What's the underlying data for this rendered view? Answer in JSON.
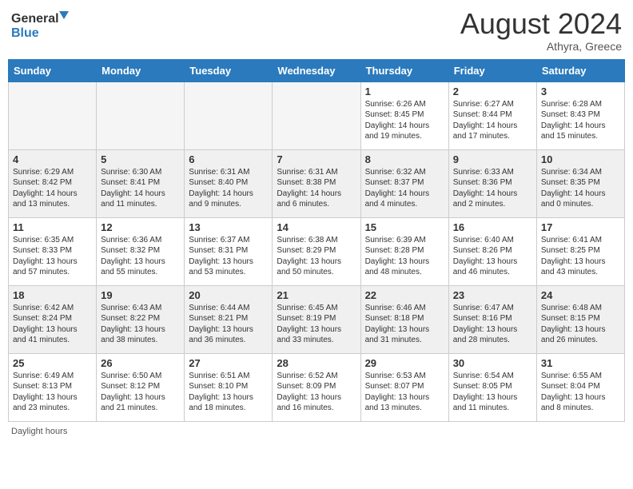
{
  "header": {
    "logo_text1": "General",
    "logo_text2": "Blue",
    "month_year": "August 2024",
    "location": "Athyra, Greece"
  },
  "days_of_week": [
    "Sunday",
    "Monday",
    "Tuesday",
    "Wednesday",
    "Thursday",
    "Friday",
    "Saturday"
  ],
  "weeks": [
    [
      {
        "day": "",
        "empty": true
      },
      {
        "day": "",
        "empty": true
      },
      {
        "day": "",
        "empty": true
      },
      {
        "day": "",
        "empty": true
      },
      {
        "day": "1",
        "sunrise": "Sunrise: 6:26 AM",
        "sunset": "Sunset: 8:45 PM",
        "daylight": "Daylight: 14 hours and 19 minutes."
      },
      {
        "day": "2",
        "sunrise": "Sunrise: 6:27 AM",
        "sunset": "Sunset: 8:44 PM",
        "daylight": "Daylight: 14 hours and 17 minutes."
      },
      {
        "day": "3",
        "sunrise": "Sunrise: 6:28 AM",
        "sunset": "Sunset: 8:43 PM",
        "daylight": "Daylight: 14 hours and 15 minutes."
      }
    ],
    [
      {
        "day": "4",
        "sunrise": "Sunrise: 6:29 AM",
        "sunset": "Sunset: 8:42 PM",
        "daylight": "Daylight: 14 hours and 13 minutes."
      },
      {
        "day": "5",
        "sunrise": "Sunrise: 6:30 AM",
        "sunset": "Sunset: 8:41 PM",
        "daylight": "Daylight: 14 hours and 11 minutes."
      },
      {
        "day": "6",
        "sunrise": "Sunrise: 6:31 AM",
        "sunset": "Sunset: 8:40 PM",
        "daylight": "Daylight: 14 hours and 9 minutes."
      },
      {
        "day": "7",
        "sunrise": "Sunrise: 6:31 AM",
        "sunset": "Sunset: 8:38 PM",
        "daylight": "Daylight: 14 hours and 6 minutes."
      },
      {
        "day": "8",
        "sunrise": "Sunrise: 6:32 AM",
        "sunset": "Sunset: 8:37 PM",
        "daylight": "Daylight: 14 hours and 4 minutes."
      },
      {
        "day": "9",
        "sunrise": "Sunrise: 6:33 AM",
        "sunset": "Sunset: 8:36 PM",
        "daylight": "Daylight: 14 hours and 2 minutes."
      },
      {
        "day": "10",
        "sunrise": "Sunrise: 6:34 AM",
        "sunset": "Sunset: 8:35 PM",
        "daylight": "Daylight: 14 hours and 0 minutes."
      }
    ],
    [
      {
        "day": "11",
        "sunrise": "Sunrise: 6:35 AM",
        "sunset": "Sunset: 8:33 PM",
        "daylight": "Daylight: 13 hours and 57 minutes."
      },
      {
        "day": "12",
        "sunrise": "Sunrise: 6:36 AM",
        "sunset": "Sunset: 8:32 PM",
        "daylight": "Daylight: 13 hours and 55 minutes."
      },
      {
        "day": "13",
        "sunrise": "Sunrise: 6:37 AM",
        "sunset": "Sunset: 8:31 PM",
        "daylight": "Daylight: 13 hours and 53 minutes."
      },
      {
        "day": "14",
        "sunrise": "Sunrise: 6:38 AM",
        "sunset": "Sunset: 8:29 PM",
        "daylight": "Daylight: 13 hours and 50 minutes."
      },
      {
        "day": "15",
        "sunrise": "Sunrise: 6:39 AM",
        "sunset": "Sunset: 8:28 PM",
        "daylight": "Daylight: 13 hours and 48 minutes."
      },
      {
        "day": "16",
        "sunrise": "Sunrise: 6:40 AM",
        "sunset": "Sunset: 8:26 PM",
        "daylight": "Daylight: 13 hours and 46 minutes."
      },
      {
        "day": "17",
        "sunrise": "Sunrise: 6:41 AM",
        "sunset": "Sunset: 8:25 PM",
        "daylight": "Daylight: 13 hours and 43 minutes."
      }
    ],
    [
      {
        "day": "18",
        "sunrise": "Sunrise: 6:42 AM",
        "sunset": "Sunset: 8:24 PM",
        "daylight": "Daylight: 13 hours and 41 minutes."
      },
      {
        "day": "19",
        "sunrise": "Sunrise: 6:43 AM",
        "sunset": "Sunset: 8:22 PM",
        "daylight": "Daylight: 13 hours and 38 minutes."
      },
      {
        "day": "20",
        "sunrise": "Sunrise: 6:44 AM",
        "sunset": "Sunset: 8:21 PM",
        "daylight": "Daylight: 13 hours and 36 minutes."
      },
      {
        "day": "21",
        "sunrise": "Sunrise: 6:45 AM",
        "sunset": "Sunset: 8:19 PM",
        "daylight": "Daylight: 13 hours and 33 minutes."
      },
      {
        "day": "22",
        "sunrise": "Sunrise: 6:46 AM",
        "sunset": "Sunset: 8:18 PM",
        "daylight": "Daylight: 13 hours and 31 minutes."
      },
      {
        "day": "23",
        "sunrise": "Sunrise: 6:47 AM",
        "sunset": "Sunset: 8:16 PM",
        "daylight": "Daylight: 13 hours and 28 minutes."
      },
      {
        "day": "24",
        "sunrise": "Sunrise: 6:48 AM",
        "sunset": "Sunset: 8:15 PM",
        "daylight": "Daylight: 13 hours and 26 minutes."
      }
    ],
    [
      {
        "day": "25",
        "sunrise": "Sunrise: 6:49 AM",
        "sunset": "Sunset: 8:13 PM",
        "daylight": "Daylight: 13 hours and 23 minutes."
      },
      {
        "day": "26",
        "sunrise": "Sunrise: 6:50 AM",
        "sunset": "Sunset: 8:12 PM",
        "daylight": "Daylight: 13 hours and 21 minutes."
      },
      {
        "day": "27",
        "sunrise": "Sunrise: 6:51 AM",
        "sunset": "Sunset: 8:10 PM",
        "daylight": "Daylight: 13 hours and 18 minutes."
      },
      {
        "day": "28",
        "sunrise": "Sunrise: 6:52 AM",
        "sunset": "Sunset: 8:09 PM",
        "daylight": "Daylight: 13 hours and 16 minutes."
      },
      {
        "day": "29",
        "sunrise": "Sunrise: 6:53 AM",
        "sunset": "Sunset: 8:07 PM",
        "daylight": "Daylight: 13 hours and 13 minutes."
      },
      {
        "day": "30",
        "sunrise": "Sunrise: 6:54 AM",
        "sunset": "Sunset: 8:05 PM",
        "daylight": "Daylight: 13 hours and 11 minutes."
      },
      {
        "day": "31",
        "sunrise": "Sunrise: 6:55 AM",
        "sunset": "Sunset: 8:04 PM",
        "daylight": "Daylight: 13 hours and 8 minutes."
      }
    ]
  ],
  "footer": {
    "label": "Daylight hours"
  }
}
